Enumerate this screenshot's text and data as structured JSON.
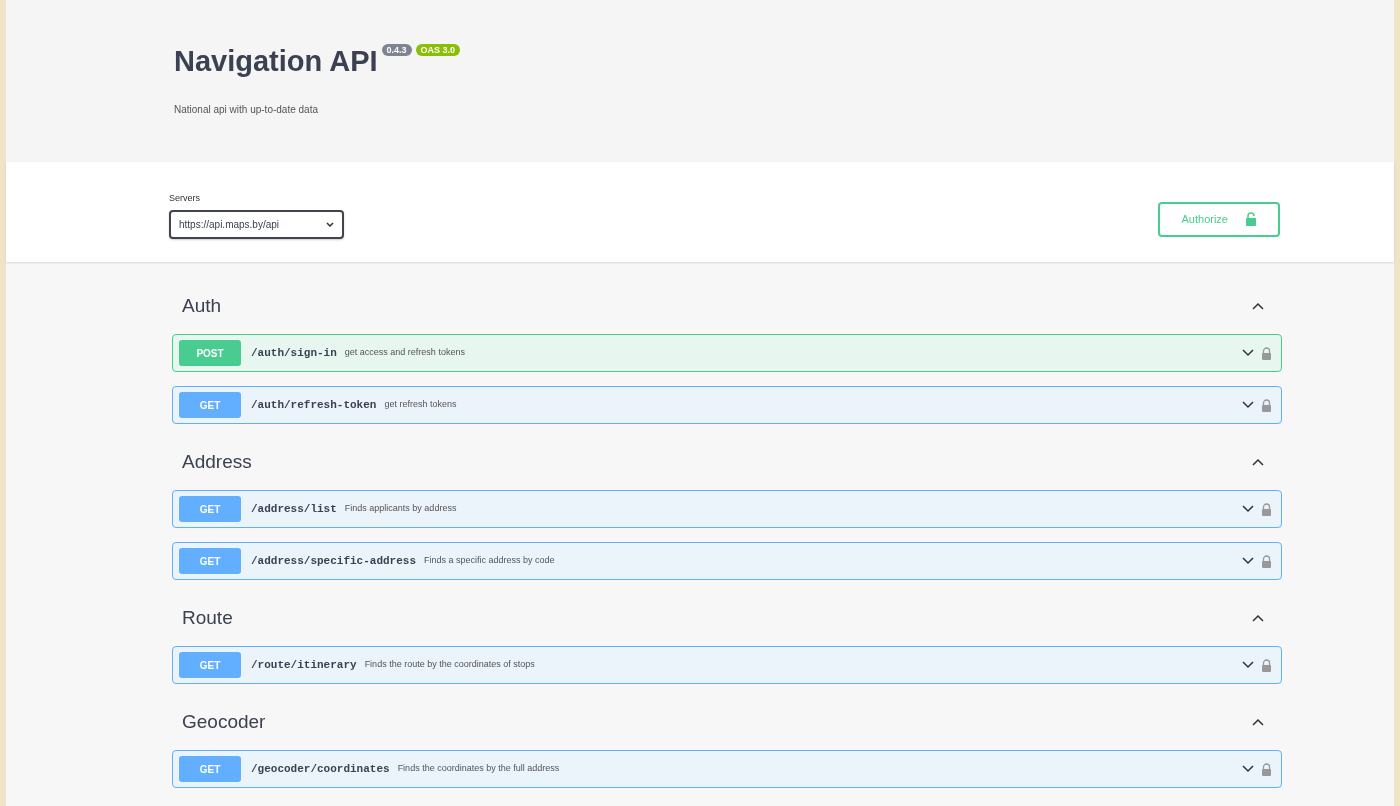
{
  "info": {
    "title": "Navigation API",
    "version": "0.4.3",
    "oas": "OAS 3.0",
    "description": "National api with up-to-date data"
  },
  "servers": {
    "label": "Servers",
    "value": "https://api.maps.by/api"
  },
  "authorize": {
    "label": "Authorize"
  },
  "tags": [
    {
      "name": "Auth",
      "expanded": true,
      "operations": [
        {
          "method": "POST",
          "kind": "post",
          "path": "/auth/sign-in",
          "summary": "get access and refresh tokens"
        },
        {
          "method": "GET",
          "kind": "get",
          "path": "/auth/refresh-token",
          "summary": "get refresh tokens"
        }
      ]
    },
    {
      "name": "Address",
      "expanded": true,
      "operations": [
        {
          "method": "GET",
          "kind": "get",
          "path": "/address/list",
          "summary": "Finds applicants by address"
        },
        {
          "method": "GET",
          "kind": "get",
          "path": "/address/specific-address",
          "summary": "Finds a specific address by code"
        }
      ]
    },
    {
      "name": "Route",
      "expanded": true,
      "operations": [
        {
          "method": "GET",
          "kind": "get",
          "path": "/route/itinerary",
          "summary": "Finds the route by the coordinates of stops"
        }
      ]
    },
    {
      "name": "Geocoder",
      "expanded": true,
      "operations": [
        {
          "method": "GET",
          "kind": "get",
          "path": "/geocoder/coordinates",
          "summary": "Finds the coordinates by the full address"
        }
      ]
    }
  ]
}
